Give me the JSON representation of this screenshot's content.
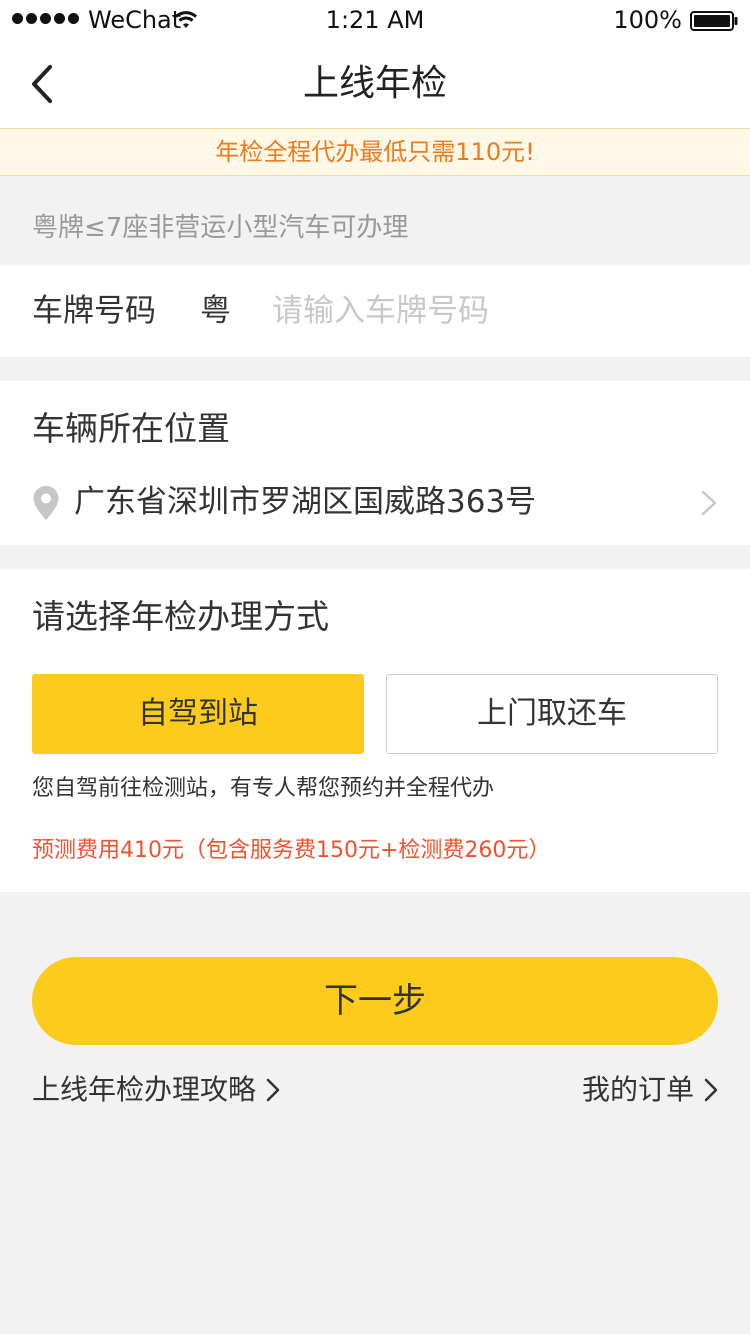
{
  "status_bar": {
    "carrier": "WeChat",
    "time": "1:21 AM",
    "battery": "100%"
  },
  "nav": {
    "title": "上线年检",
    "back_icon": "chevron-left-icon"
  },
  "promo": {
    "text": "年检全程代办最低只需110元!"
  },
  "eligibility_note": "粤牌≤7座非营运小型汽车可办理",
  "plate": {
    "label": "车牌号码",
    "prefix": "粤",
    "placeholder": "请输入车牌号码",
    "value": ""
  },
  "location": {
    "title": "车辆所在位置",
    "address": "广东省深圳市罗湖区国威路363号",
    "icon": "location-pin-icon"
  },
  "method": {
    "title": "请选择年检办理方式",
    "options": [
      {
        "label": "自驾到站",
        "selected": true
      },
      {
        "label": "上门取还车",
        "selected": false
      }
    ],
    "description": "您自驾前往检测站，有专人帮您预约并全程代办",
    "fee": "预测费用410元（包含服务费150元+检测费260元）"
  },
  "next_button": "下一步",
  "footer": {
    "guide_link": "上线年检办理攻略",
    "orders_link": "我的订单"
  },
  "colors": {
    "accent_yellow": "#fccb1b",
    "promo_orange": "#f07b1d",
    "fee_red": "#f0522d",
    "background": "#f2f2f2"
  }
}
